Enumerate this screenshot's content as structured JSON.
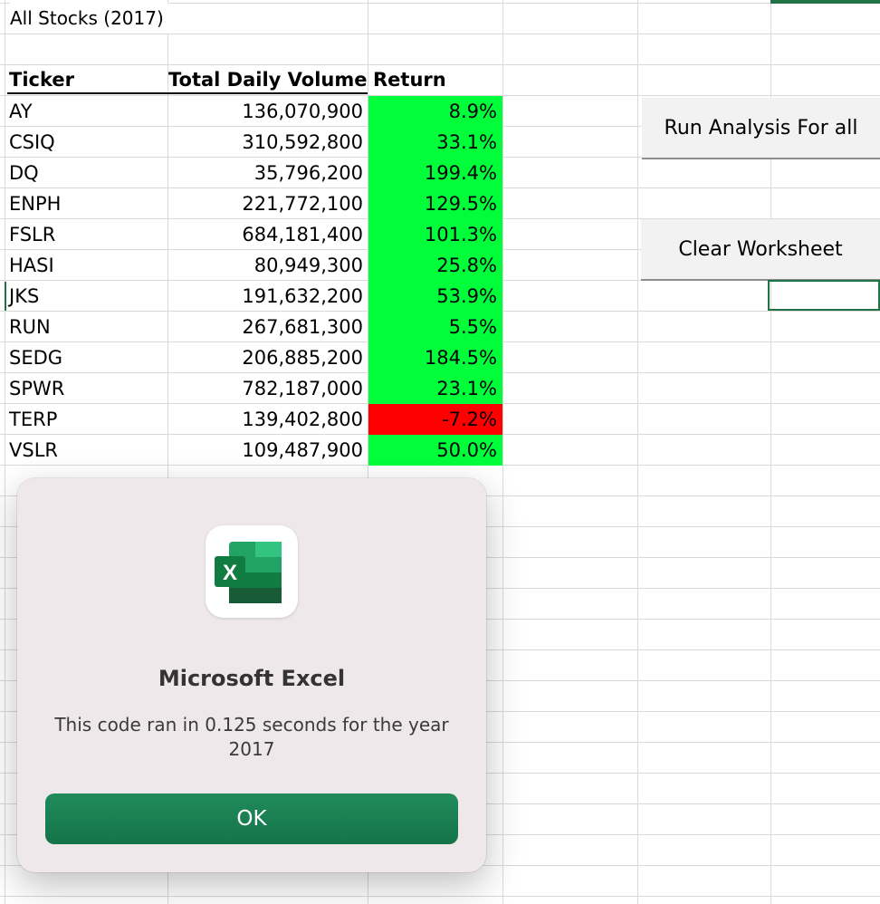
{
  "sheet": {
    "title": "All Stocks (2017)",
    "headers": {
      "ticker": "Ticker",
      "volume": "Total Daily Volume",
      "return": "Return"
    },
    "rows": [
      {
        "ticker": "AY",
        "volume": "136,070,900",
        "return": "8.9%",
        "return_color": "#00ff3a"
      },
      {
        "ticker": "CSIQ",
        "volume": "310,592,800",
        "return": "33.1%",
        "return_color": "#00ff3a"
      },
      {
        "ticker": "DQ",
        "volume": "35,796,200",
        "return": "199.4%",
        "return_color": "#00ff3a"
      },
      {
        "ticker": "ENPH",
        "volume": "221,772,100",
        "return": "129.5%",
        "return_color": "#00ff3a"
      },
      {
        "ticker": "FSLR",
        "volume": "684,181,400",
        "return": "101.3%",
        "return_color": "#00ff3a"
      },
      {
        "ticker": "HASI",
        "volume": "80,949,300",
        "return": "25.8%",
        "return_color": "#00ff3a"
      },
      {
        "ticker": "JKS",
        "volume": "191,632,200",
        "return": "53.9%",
        "return_color": "#00ff3a"
      },
      {
        "ticker": "RUN",
        "volume": "267,681,300",
        "return": "5.5%",
        "return_color": "#00ff3a"
      },
      {
        "ticker": "SEDG",
        "volume": "206,885,200",
        "return": "184.5%",
        "return_color": "#00ff3a"
      },
      {
        "ticker": "SPWR",
        "volume": "782,187,000",
        "return": "23.1%",
        "return_color": "#00ff3a"
      },
      {
        "ticker": "TERP",
        "volume": "139,402,800",
        "return": "-7.2%",
        "return_color": "#ff0000"
      },
      {
        "ticker": "VSLR",
        "volume": "109,487,900",
        "return": "50.0%",
        "return_color": "#00ff3a"
      }
    ],
    "buttons": {
      "run_all": "Run Analysis For all",
      "clear": "Clear Worksheet"
    }
  },
  "dialog": {
    "app_icon": "excel-icon",
    "icon_letter": "X",
    "title": "Microsoft Excel",
    "message": "This code ran in 0.125 seconds for the year 2017",
    "ok_label": "OK",
    "accent_color": "#1a7f50"
  }
}
